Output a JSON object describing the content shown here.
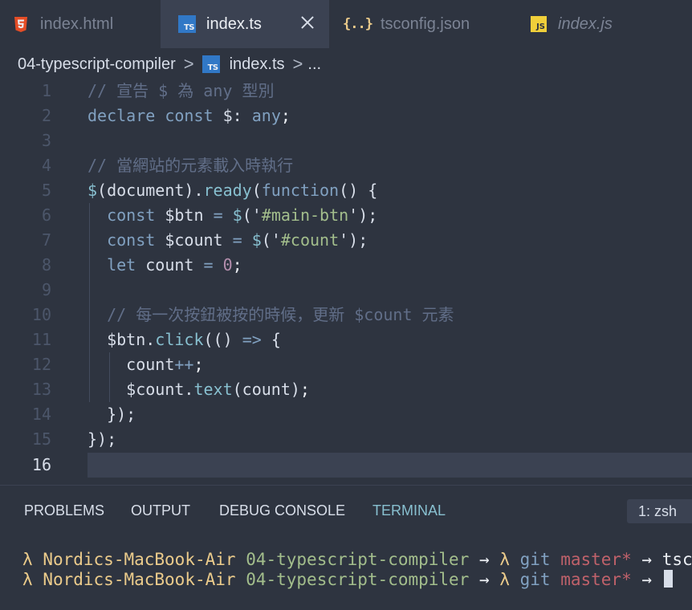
{
  "tabs": [
    {
      "label": "index.html",
      "icon": "html5-icon"
    },
    {
      "label": "index.ts",
      "icon": "typescript-icon",
      "active": true
    },
    {
      "label": "tsconfig.json",
      "icon": "json-braces-icon"
    },
    {
      "label": "index.js",
      "icon": "javascript-icon",
      "italic": true
    }
  ],
  "icons": {
    "ts_text": "TS",
    "js_text": "JS",
    "json_text": "{..}"
  },
  "breadcrumb": {
    "folder": "04-typescript-compiler",
    "sep": ">",
    "file": "index.ts",
    "more": "..."
  },
  "editor": {
    "current_line": "16",
    "lines": [
      {
        "num": "1",
        "c1": "// 宣告 $ 為 any 型別"
      },
      {
        "num": "2",
        "c1": "declare",
        "c2": " ",
        "c3": "const",
        "c4": " $: ",
        "c5": "any",
        "c6": ";"
      },
      {
        "num": "3"
      },
      {
        "num": "4",
        "c1": "// 當網站的元素載入時執行"
      },
      {
        "num": "5",
        "c1": "$",
        "c2": "(document).",
        "c3": "ready",
        "c4": "(",
        "c5": "function",
        "c6": "() {"
      },
      {
        "num": "6",
        "c1": "  ",
        "c2": "const",
        "c3": " $btn ",
        "c4": "=",
        "c5": " ",
        "c6": "$",
        "c7": "('",
        "c8": "#main-btn",
        "c9": "');"
      },
      {
        "num": "7",
        "c1": "  ",
        "c2": "const",
        "c3": " $count ",
        "c4": "=",
        "c5": " ",
        "c6": "$",
        "c7": "('",
        "c8": "#count",
        "c9": "');"
      },
      {
        "num": "8",
        "c1": "  ",
        "c2": "let",
        "c3": " count ",
        "c4": "=",
        "c5": " ",
        "c6": "0",
        "c7": ";"
      },
      {
        "num": "9"
      },
      {
        "num": "10",
        "c1": "  // 每一次按鈕被按的時候，更新 $count 元素"
      },
      {
        "num": "11",
        "c1": "  $btn.",
        "c2": "click",
        "c3": "(() ",
        "c4": "=>",
        "c5": " {"
      },
      {
        "num": "12",
        "c1": "    count",
        "c2": "++",
        "c3": ";"
      },
      {
        "num": "13",
        "c1": "    $count.",
        "c2": "text",
        "c3": "(count)",
        "c4": ";"
      },
      {
        "num": "14",
        "c1": "  });"
      },
      {
        "num": "15",
        "c1": "});"
      },
      {
        "num": "16"
      }
    ]
  },
  "panel": {
    "tabs": [
      "PROBLEMS",
      "OUTPUT",
      "DEBUG CONSOLE",
      "TERMINAL"
    ],
    "active_tab": "TERMINAL",
    "terminal_select": "1: zsh"
  },
  "terminal": {
    "lines": [
      {
        "lambda": "λ",
        "host": "Nordics-MacBook-Air",
        "dir": "04-typescript-compiler",
        "arrow1": "→",
        "lambda2": "λ",
        "git": "git",
        "branch": "master*",
        "arrow2": "→",
        "cmd": "tsc"
      },
      {
        "lambda": "λ",
        "host": "Nordics-MacBook-Air",
        "dir": "04-typescript-compiler",
        "arrow1": "→",
        "lambda2": "λ",
        "git": "git",
        "branch": "master*",
        "arrow2": "→",
        "cmd": ""
      }
    ]
  },
  "colors": {
    "background": "#2e3440",
    "active_tab": "#3b4252",
    "keyword": "#81a1c1",
    "function": "#88c0d0",
    "string": "#a3be8c",
    "number": "#b48ead",
    "comment": "#616e88",
    "terminal_host": "#ebcb8b",
    "terminal_branch": "#bf616a"
  }
}
